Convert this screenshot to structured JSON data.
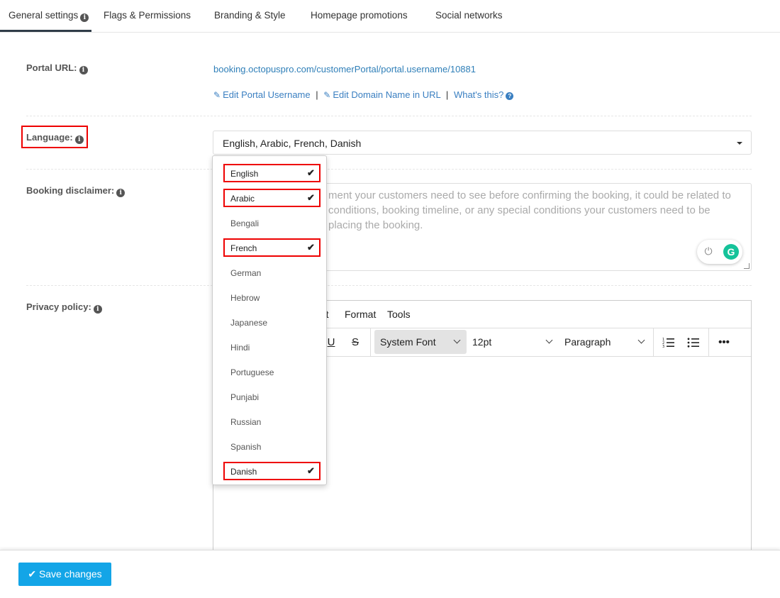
{
  "tabs": [
    {
      "label": "General settings"
    },
    {
      "label": "Flags & Permissions"
    },
    {
      "label": "Branding & Style"
    },
    {
      "label": "Homepage promotions"
    },
    {
      "label": "Social networks"
    }
  ],
  "portal": {
    "label": "Portal URL:",
    "url": "booking.octopuspro.com/customerPortal/portal.username/10881",
    "edit_username": "Edit Portal Username",
    "edit_domain": "Edit Domain Name in URL",
    "whats_this": "What's this?",
    "divider": "|"
  },
  "language": {
    "label": "Language:",
    "selected_value": "English, Arabic, French, Danish",
    "options": [
      {
        "label": "English",
        "checked": "✔"
      },
      {
        "label": "Arabic",
        "checked": "✔"
      },
      {
        "label": "Bengali",
        "checked": ""
      },
      {
        "label": "French",
        "checked": "✔"
      },
      {
        "label": "German",
        "checked": ""
      },
      {
        "label": "Hebrow",
        "checked": ""
      },
      {
        "label": "Japanese",
        "checked": ""
      },
      {
        "label": "Hindi",
        "checked": ""
      },
      {
        "label": "Portuguese",
        "checked": ""
      },
      {
        "label": "Punjabi",
        "checked": ""
      },
      {
        "label": "Russian",
        "checked": ""
      },
      {
        "label": "Spanish",
        "checked": ""
      },
      {
        "label": "Danish",
        "checked": "✔"
      }
    ]
  },
  "booking_disclaimer": {
    "label": "Booking disclaimer:",
    "lines": [
      "ment your customers need to see before confirming the booking, it could be related to",
      "conditions, booking timeline, or any special conditions your customers need to be",
      "placing the booking."
    ],
    "grammarly_letter": "G"
  },
  "privacy_policy": {
    "label": "Privacy policy:",
    "menu": [
      "rt",
      "Format",
      "Tools"
    ],
    "font": "System Font",
    "size": "12pt",
    "block": "Paragraph",
    "underline": "U",
    "strike": "S"
  },
  "footer": {
    "save_label": "Save changes"
  },
  "colors": {
    "accent": "#13a5e7",
    "link": "#3a7fc1",
    "highlight": "#e00000"
  }
}
